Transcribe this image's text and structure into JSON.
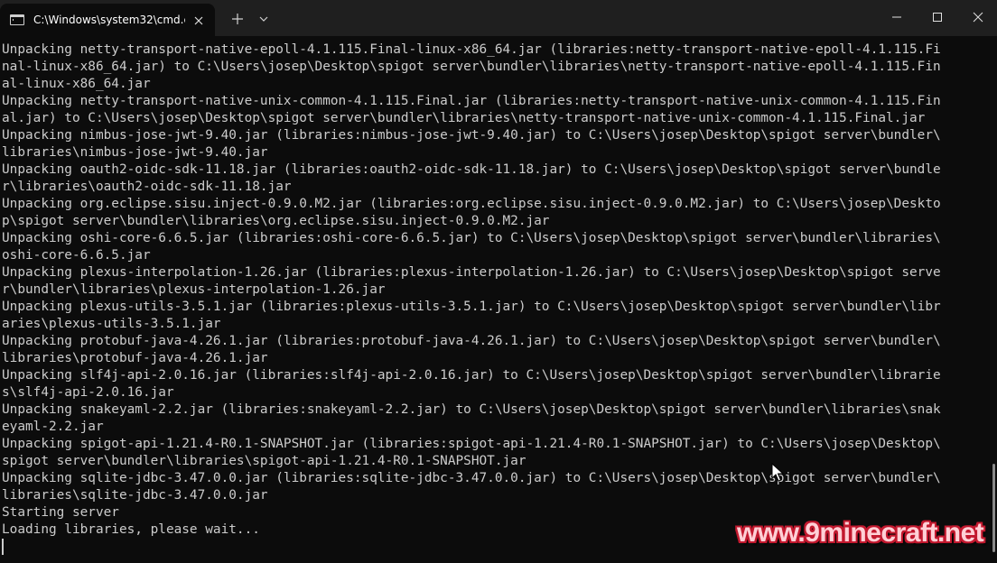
{
  "tab": {
    "title": "C:\\Windows\\system32\\cmd.e:",
    "icon": "terminal-icon"
  },
  "titlebar": {
    "new_tab_icon": "plus-icon",
    "dropdown_icon": "chevron-down-icon",
    "minimize_icon": "minimize-icon",
    "maximize_icon": "maximize-icon",
    "close_icon": "close-icon"
  },
  "console": {
    "lines": [
      "Unpacking netty-transport-native-epoll-4.1.115.Final-linux-x86_64.jar (libraries:netty-transport-native-epoll-4.1.115.Fi",
      "nal-linux-x86_64.jar) to C:\\Users\\josep\\Desktop\\spigot server\\bundler\\libraries\\netty-transport-native-epoll-4.1.115.Fin",
      "al-linux-x86_64.jar",
      "Unpacking netty-transport-native-unix-common-4.1.115.Final.jar (libraries:netty-transport-native-unix-common-4.1.115.Fin",
      "al.jar) to C:\\Users\\josep\\Desktop\\spigot server\\bundler\\libraries\\netty-transport-native-unix-common-4.1.115.Final.jar",
      "Unpacking nimbus-jose-jwt-9.40.jar (libraries:nimbus-jose-jwt-9.40.jar) to C:\\Users\\josep\\Desktop\\spigot server\\bundler\\",
      "libraries\\nimbus-jose-jwt-9.40.jar",
      "Unpacking oauth2-oidc-sdk-11.18.jar (libraries:oauth2-oidc-sdk-11.18.jar) to C:\\Users\\josep\\Desktop\\spigot server\\bundle",
      "r\\libraries\\oauth2-oidc-sdk-11.18.jar",
      "Unpacking org.eclipse.sisu.inject-0.9.0.M2.jar (libraries:org.eclipse.sisu.inject-0.9.0.M2.jar) to C:\\Users\\josep\\Deskto",
      "p\\spigot server\\bundler\\libraries\\org.eclipse.sisu.inject-0.9.0.M2.jar",
      "Unpacking oshi-core-6.6.5.jar (libraries:oshi-core-6.6.5.jar) to C:\\Users\\josep\\Desktop\\spigot server\\bundler\\libraries\\",
      "oshi-core-6.6.5.jar",
      "Unpacking plexus-interpolation-1.26.jar (libraries:plexus-interpolation-1.26.jar) to C:\\Users\\josep\\Desktop\\spigot serve",
      "r\\bundler\\libraries\\plexus-interpolation-1.26.jar",
      "Unpacking plexus-utils-3.5.1.jar (libraries:plexus-utils-3.5.1.jar) to C:\\Users\\josep\\Desktop\\spigot server\\bundler\\libr",
      "aries\\plexus-utils-3.5.1.jar",
      "Unpacking protobuf-java-4.26.1.jar (libraries:protobuf-java-4.26.1.jar) to C:\\Users\\josep\\Desktop\\spigot server\\bundler\\",
      "libraries\\protobuf-java-4.26.1.jar",
      "Unpacking slf4j-api-2.0.16.jar (libraries:slf4j-api-2.0.16.jar) to C:\\Users\\josep\\Desktop\\spigot server\\bundler\\librarie",
      "s\\slf4j-api-2.0.16.jar",
      "Unpacking snakeyaml-2.2.jar (libraries:snakeyaml-2.2.jar) to C:\\Users\\josep\\Desktop\\spigot server\\bundler\\libraries\\snak",
      "eyaml-2.2.jar",
      "Unpacking spigot-api-1.21.4-R0.1-SNAPSHOT.jar (libraries:spigot-api-1.21.4-R0.1-SNAPSHOT.jar) to C:\\Users\\josep\\Desktop\\",
      "spigot server\\bundler\\libraries\\spigot-api-1.21.4-R0.1-SNAPSHOT.jar",
      "Unpacking sqlite-jdbc-3.47.0.0.jar (libraries:sqlite-jdbc-3.47.0.0.jar) to C:\\Users\\josep\\Desktop\\spigot server\\bundler\\",
      "libraries\\sqlite-jdbc-3.47.0.0.jar",
      "Starting server",
      "Loading libraries, please wait..."
    ],
    "text_color": "#cccccc",
    "background": "#0c0c0c"
  },
  "watermark": {
    "text": "www.9minecraft.net"
  }
}
